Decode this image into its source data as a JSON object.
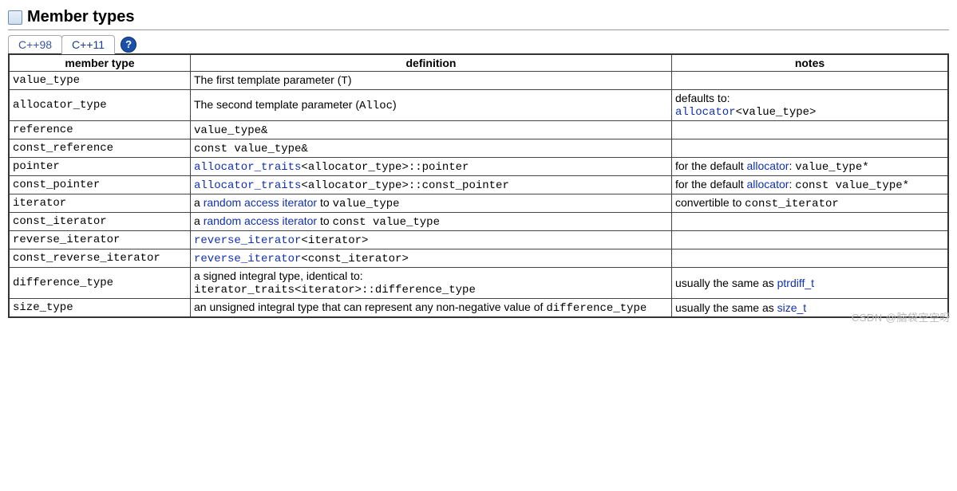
{
  "heading": "Member types",
  "tabs": {
    "items": [
      {
        "label": "C++98",
        "active": false
      },
      {
        "label": "C++11",
        "active": true
      }
    ],
    "help_glyph": "?"
  },
  "table": {
    "headers": {
      "member_type": "member type",
      "definition": "definition",
      "notes": "notes"
    },
    "rows": [
      {
        "member": "value_type",
        "def": [
          {
            "t": "The first template parameter ("
          },
          {
            "t": "T",
            "tt": true
          },
          {
            "t": ")"
          }
        ],
        "notes": []
      },
      {
        "member": "allocator_type",
        "def": [
          {
            "t": "The second template parameter ("
          },
          {
            "t": "Alloc",
            "tt": true
          },
          {
            "t": ")"
          }
        ],
        "notes": [
          {
            "t": "defaults to: "
          },
          {
            "br": true
          },
          {
            "t": "allocator",
            "tt": true,
            "link": true
          },
          {
            "t": "<value_type>",
            "tt": true
          }
        ]
      },
      {
        "member": "reference",
        "def": [
          {
            "t": "value_type&",
            "tt": true
          }
        ],
        "notes": []
      },
      {
        "member": "const_reference",
        "def": [
          {
            "t": "const value_type&",
            "tt": true
          }
        ],
        "notes": []
      },
      {
        "member": "pointer",
        "def": [
          {
            "t": "allocator_traits",
            "tt": true,
            "link": true
          },
          {
            "t": "<allocator_type>::pointer",
            "tt": true
          }
        ],
        "notes": [
          {
            "t": "for the default "
          },
          {
            "t": "allocator",
            "link": true
          },
          {
            "t": ": "
          },
          {
            "t": "value_type*",
            "tt": true
          }
        ]
      },
      {
        "member": "const_pointer",
        "def": [
          {
            "t": "allocator_traits",
            "tt": true,
            "link": true
          },
          {
            "t": "<allocator_type>::const_pointer",
            "tt": true
          }
        ],
        "notes": [
          {
            "t": "for the default "
          },
          {
            "t": "allocator",
            "link": true
          },
          {
            "t": ": "
          },
          {
            "t": "const value_type*",
            "tt": true
          }
        ]
      },
      {
        "member": "iterator",
        "def": [
          {
            "t": "a "
          },
          {
            "t": "random access iterator",
            "link": true
          },
          {
            "t": " to "
          },
          {
            "t": "value_type",
            "tt": true
          }
        ],
        "notes": [
          {
            "t": "convertible to "
          },
          {
            "t": "const_iterator",
            "tt": true
          }
        ]
      },
      {
        "member": "const_iterator",
        "def": [
          {
            "t": "a "
          },
          {
            "t": "random access iterator",
            "link": true
          },
          {
            "t": " to "
          },
          {
            "t": "const value_type",
            "tt": true
          }
        ],
        "notes": []
      },
      {
        "member": "reverse_iterator",
        "def": [
          {
            "t": "reverse_iterator",
            "tt": true,
            "link": true
          },
          {
            "t": "<iterator>",
            "tt": true
          }
        ],
        "notes": []
      },
      {
        "member": "const_reverse_iterator",
        "def": [
          {
            "t": "reverse_iterator",
            "tt": true,
            "link": true
          },
          {
            "t": "<const_iterator>",
            "tt": true
          }
        ],
        "notes": []
      },
      {
        "member": "difference_type",
        "def": [
          {
            "t": "a signed integral type, identical to:"
          },
          {
            "br": true
          },
          {
            "t": "iterator_traits<iterator>::difference_type",
            "tt": true
          }
        ],
        "notes": [
          {
            "t": "usually the same as "
          },
          {
            "t": "ptrdiff_t",
            "link": true
          }
        ]
      },
      {
        "member": "size_type",
        "def": [
          {
            "t": "an unsigned integral type that can represent any non-negative value of "
          },
          {
            "t": "difference_type",
            "tt": true
          }
        ],
        "notes": [
          {
            "t": "usually the same as "
          },
          {
            "t": "size_t",
            "link": true
          }
        ]
      }
    ]
  },
  "watermark": "CSDN @脑袋空空呀"
}
